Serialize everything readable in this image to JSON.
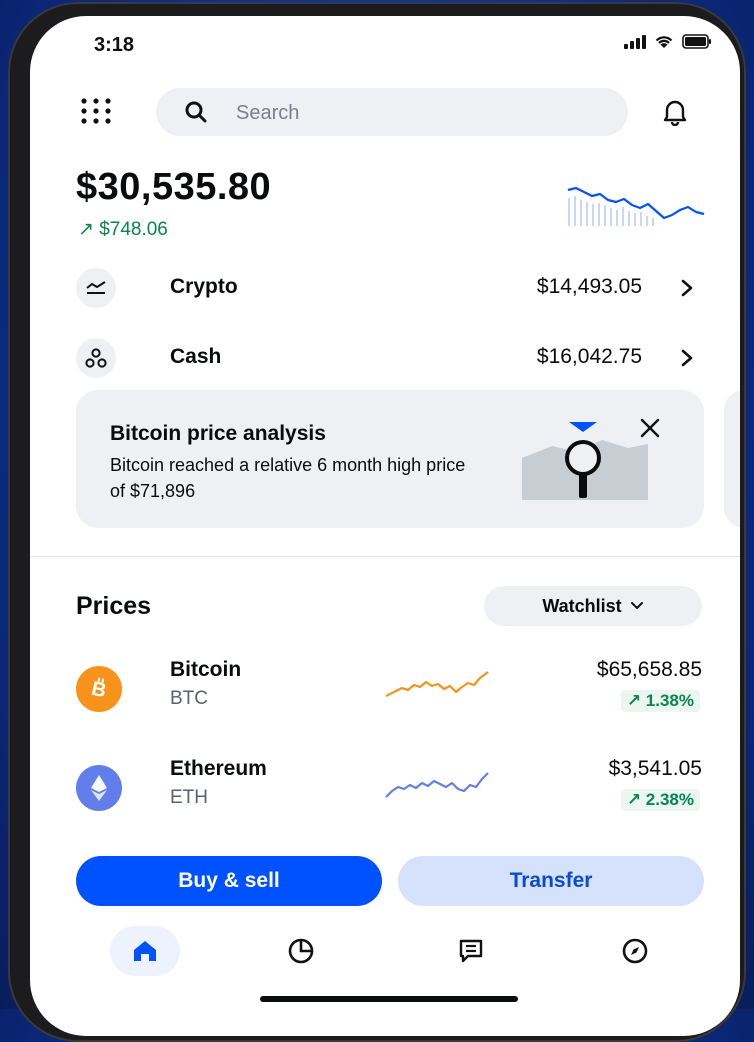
{
  "status_bar": {
    "time": "3:18"
  },
  "search": {
    "placeholder": "Search"
  },
  "portfolio": {
    "balance": "$30,535.80",
    "change": "↗ $748.06"
  },
  "accounts": [
    {
      "label": "Crypto",
      "amount": "$14,493.05"
    },
    {
      "label": "Cash",
      "amount": "$16,042.75"
    }
  ],
  "promo_card": {
    "title": "Bitcoin price analysis",
    "body": "Bitcoin reached a relative 6 month high price of $71,896"
  },
  "prices": {
    "title": "Prices",
    "filter_label": "Watchlist",
    "assets": [
      {
        "name": "Bitcoin",
        "symbol": "BTC",
        "price": "$65,658.85",
        "change": "↗ 1.38%",
        "color": "#f7931a"
      },
      {
        "name": "Ethereum",
        "symbol": "ETH",
        "price": "$3,541.05",
        "change": "↗ 2.38%",
        "color": "#627eea"
      }
    ]
  },
  "actions": {
    "buy_sell": "Buy & sell",
    "transfer": "Transfer"
  },
  "tabs": [
    {
      "icon": "home-icon",
      "active": true
    },
    {
      "icon": "pie-chart-icon",
      "active": false
    },
    {
      "icon": "news-icon",
      "active": false
    },
    {
      "icon": "explore-icon",
      "active": false
    }
  ],
  "colors": {
    "brand_blue": "#0052ff",
    "positive_green": "#098551",
    "surface": "#eef0f3"
  }
}
